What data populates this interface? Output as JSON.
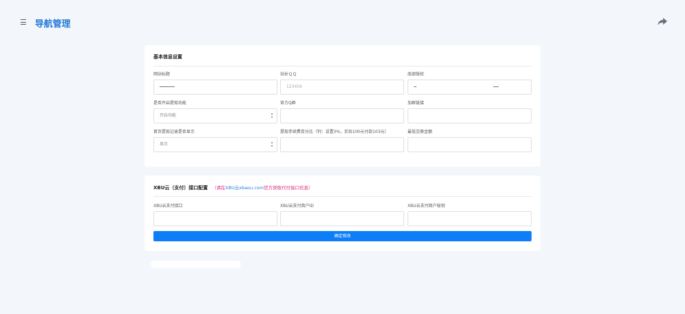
{
  "header": {
    "title": "导航管理"
  },
  "basic": {
    "title": "基本信息设置",
    "fields": {
      "site_title": {
        "label": "网站标题",
        "value": ""
      },
      "owner_qq": {
        "label": "站长ＱＱ",
        "placeholder": "123456"
      },
      "copyright": {
        "label": "底部版权",
        "value": ""
      },
      "withdraw_enable": {
        "label": "是否开启提现功能",
        "value": "开启功能"
      },
      "qq_group": {
        "label": "官方Q群",
        "value": ""
      },
      "group_link": {
        "label": "加群链接",
        "value": ""
      },
      "show_withdraw_log": {
        "label": "首页提现记录是否显示",
        "value": "显示"
      },
      "withdraw_fee": {
        "label": "提现手续费百分比（列：设置3%，实际100元付款103元）",
        "value": ""
      },
      "min_exchange": {
        "label": "最低交换金额",
        "value": ""
      }
    }
  },
  "payment": {
    "title": "XBU云（支付）接口配置",
    "note_prefix": "（请在",
    "note_link": "XBU云xbaou.com",
    "note_suffix": "官方获取代付接口信息）",
    "fields": {
      "pay_api": {
        "label": "XBU云支付接口",
        "value": ""
      },
      "merchant_id": {
        "label": "XBU云支付商户ID",
        "value": ""
      },
      "merchant_key": {
        "label": "XBU云支付商户秘钥",
        "value": ""
      }
    },
    "submit_label": "确定修改"
  },
  "icons": {
    "menu": "menu-icon",
    "share": "share-icon"
  },
  "colors": {
    "accent": "#0d7ef8",
    "title": "#2478d6",
    "note": "#d9297f",
    "background": "#f3f6fb"
  }
}
